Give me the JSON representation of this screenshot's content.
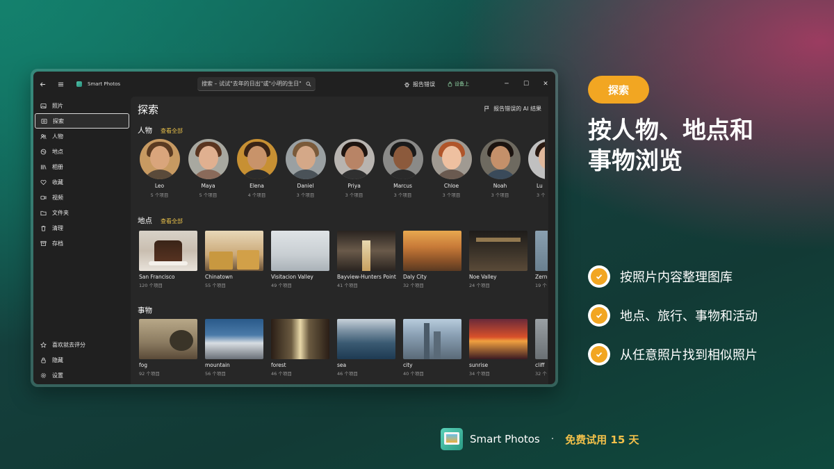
{
  "window": {
    "app_title": "Smart Photos",
    "search_placeholder": "搜索 – 试试\"去年的日出\"或\"小明的生日\"",
    "report_bug": "报告错误",
    "device_label": "设备上"
  },
  "sidebar": {
    "items": [
      {
        "label": "照片",
        "icon": "photo-icon"
      },
      {
        "label": "探索",
        "icon": "explore-icon"
      },
      {
        "label": "人物",
        "icon": "people-icon"
      },
      {
        "label": "地点",
        "icon": "places-icon"
      },
      {
        "label": "相册",
        "icon": "albums-icon"
      },
      {
        "label": "收藏",
        "icon": "heart-icon"
      },
      {
        "label": "视频",
        "icon": "video-icon"
      },
      {
        "label": "文件夹",
        "icon": "folder-icon"
      },
      {
        "label": "清理",
        "icon": "trash-icon"
      },
      {
        "label": "存档",
        "icon": "archive-icon"
      }
    ],
    "bottom": [
      {
        "label": "喜欢就去评分",
        "icon": "star-icon"
      },
      {
        "label": "隐藏",
        "icon": "lock-icon"
      },
      {
        "label": "设置",
        "icon": "gear-icon"
      }
    ]
  },
  "content": {
    "title": "探索",
    "report_ai": "报告错误的 AI 结果",
    "people": {
      "heading": "人物",
      "view_all": "查看全部",
      "items": [
        {
          "name": "Leo",
          "count": "5 个项目"
        },
        {
          "name": "Maya",
          "count": "5 个项目"
        },
        {
          "name": "Elena",
          "count": "4 个项目"
        },
        {
          "name": "Daniel",
          "count": "3 个项目"
        },
        {
          "name": "Priya",
          "count": "3 个项目"
        },
        {
          "name": "Marcus",
          "count": "3 个项目"
        },
        {
          "name": "Chloe",
          "count": "3 个项目"
        },
        {
          "name": "Noah",
          "count": "3 个项目"
        },
        {
          "name": "Lu",
          "count": "3 个"
        }
      ]
    },
    "places": {
      "heading": "地点",
      "view_all": "查看全部",
      "items": [
        {
          "name": "San Francisco",
          "count": "120 个项目"
        },
        {
          "name": "Chinatown",
          "count": "55 个项目"
        },
        {
          "name": "Visitacion Valley",
          "count": "49 个项目"
        },
        {
          "name": "Bayview-Hunters Point",
          "count": "41 个项目"
        },
        {
          "name": "Daly City",
          "count": "32 个项目"
        },
        {
          "name": "Noe Valley",
          "count": "24 个项目"
        },
        {
          "name": "Zern",
          "count": "19 个"
        }
      ]
    },
    "things": {
      "heading": "事物",
      "items": [
        {
          "name": "fog",
          "count": "92 个项目"
        },
        {
          "name": "mountain",
          "count": "56 个项目"
        },
        {
          "name": "forest",
          "count": "46 个项目"
        },
        {
          "name": "sea",
          "count": "46 个项目"
        },
        {
          "name": "city",
          "count": "40 个项目"
        },
        {
          "name": "sunrise",
          "count": "34 个项目"
        },
        {
          "name": "cliff",
          "count": "32 个"
        }
      ]
    }
  },
  "promo": {
    "pill": "探索",
    "headline_line1": "按人物、地点和",
    "headline_line2": "事物浏览",
    "features": [
      "按照片内容整理图库",
      "地点、旅行、事物和活动",
      "从任意照片找到相似照片"
    ],
    "footer_app": "Smart Photos",
    "footer_sep": "·",
    "footer_trial": "免费试用 15 天"
  },
  "colors": {
    "accent": "#f2a622",
    "window_bg": "#202020",
    "content_bg": "#272727"
  }
}
